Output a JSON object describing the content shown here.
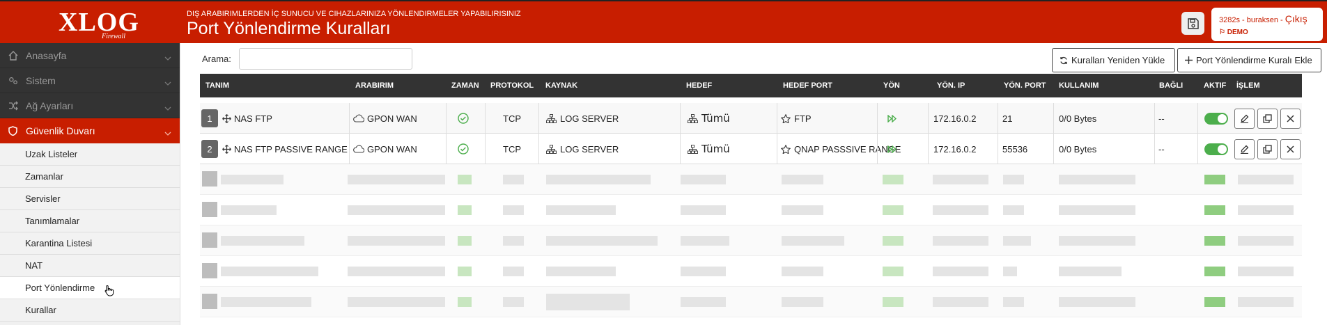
{
  "app": {
    "logo_text": "XLOG",
    "logo_sub": "Firewall",
    "subtitle": "DIŞ ARABIRIMLERDEN İÇ SUNUCU VE CIHAZLARINIZA YÖNLENDIRMELER YAPABILIRISINIZ",
    "page_title": "Port Yönlendirme Kuralları",
    "user": "3282s - buraksen",
    "exit_label": "Çıkış",
    "demo_label": "DEMO",
    "save_icon": "save-icon"
  },
  "sidebar": {
    "menus": [
      {
        "label": "Anasayfa",
        "icon": "home-icon"
      },
      {
        "label": "Sistem",
        "icon": "cogs-icon"
      },
      {
        "label": "Ağ Ayarları",
        "icon": "network-icon"
      },
      {
        "label": "Güvenlik Duvarı",
        "icon": "shield-icon"
      }
    ],
    "subitems": [
      "Uzak Listeler",
      "Zamanlar",
      "Servisler",
      "Tanımlamalar",
      "Karantina Listesi",
      "NAT",
      "Port Yönlendirme",
      "Kurallar"
    ],
    "current": "Port Yönlendirme"
  },
  "toolbar": {
    "search_label": "Arama:",
    "search_value": "",
    "search_placeholder": "",
    "reload_label": "Kuralları Yeniden Yükle",
    "add_label": "Port Yönlendirme Kuralı Ekle"
  },
  "table": {
    "headers": [
      "TANIM",
      "ARABIRIM",
      "ZAMAN",
      "PROTOKOL",
      "KAYNAK",
      "HEDEF",
      "HEDEF PORT",
      "YÖN",
      "YÖN. IP",
      "YÖN. PORT",
      "KULLANIM",
      "BAĞLI",
      "AKTIF",
      "İŞLEM"
    ],
    "rows": [
      {
        "num": "1",
        "name": "NAS FTP",
        "iface": "GPON WAN",
        "proto": "TCP",
        "source": "LOG SERVER",
        "dest": "Tümü",
        "dest_port": "FTP",
        "dir_ip": "172.16.0.2",
        "dir_port": "21",
        "usage": "0/0 Bytes",
        "linked": "--",
        "active": true
      },
      {
        "num": "2",
        "name": "NAS FTP PASSIVE RANGE",
        "iface": "GPON WAN",
        "proto": "TCP",
        "source": "LOG SERVER",
        "dest": "Tümü",
        "dest_port": "QNAP PASSSIVE RANGE",
        "dir_ip": "172.16.0.2",
        "dir_port": "55536",
        "usage": "0/0 Bytes",
        "linked": "--",
        "active": true
      }
    ]
  },
  "colors": {
    "brand": "#c81e00",
    "dark": "#333333",
    "ok": "#4cae4c"
  }
}
